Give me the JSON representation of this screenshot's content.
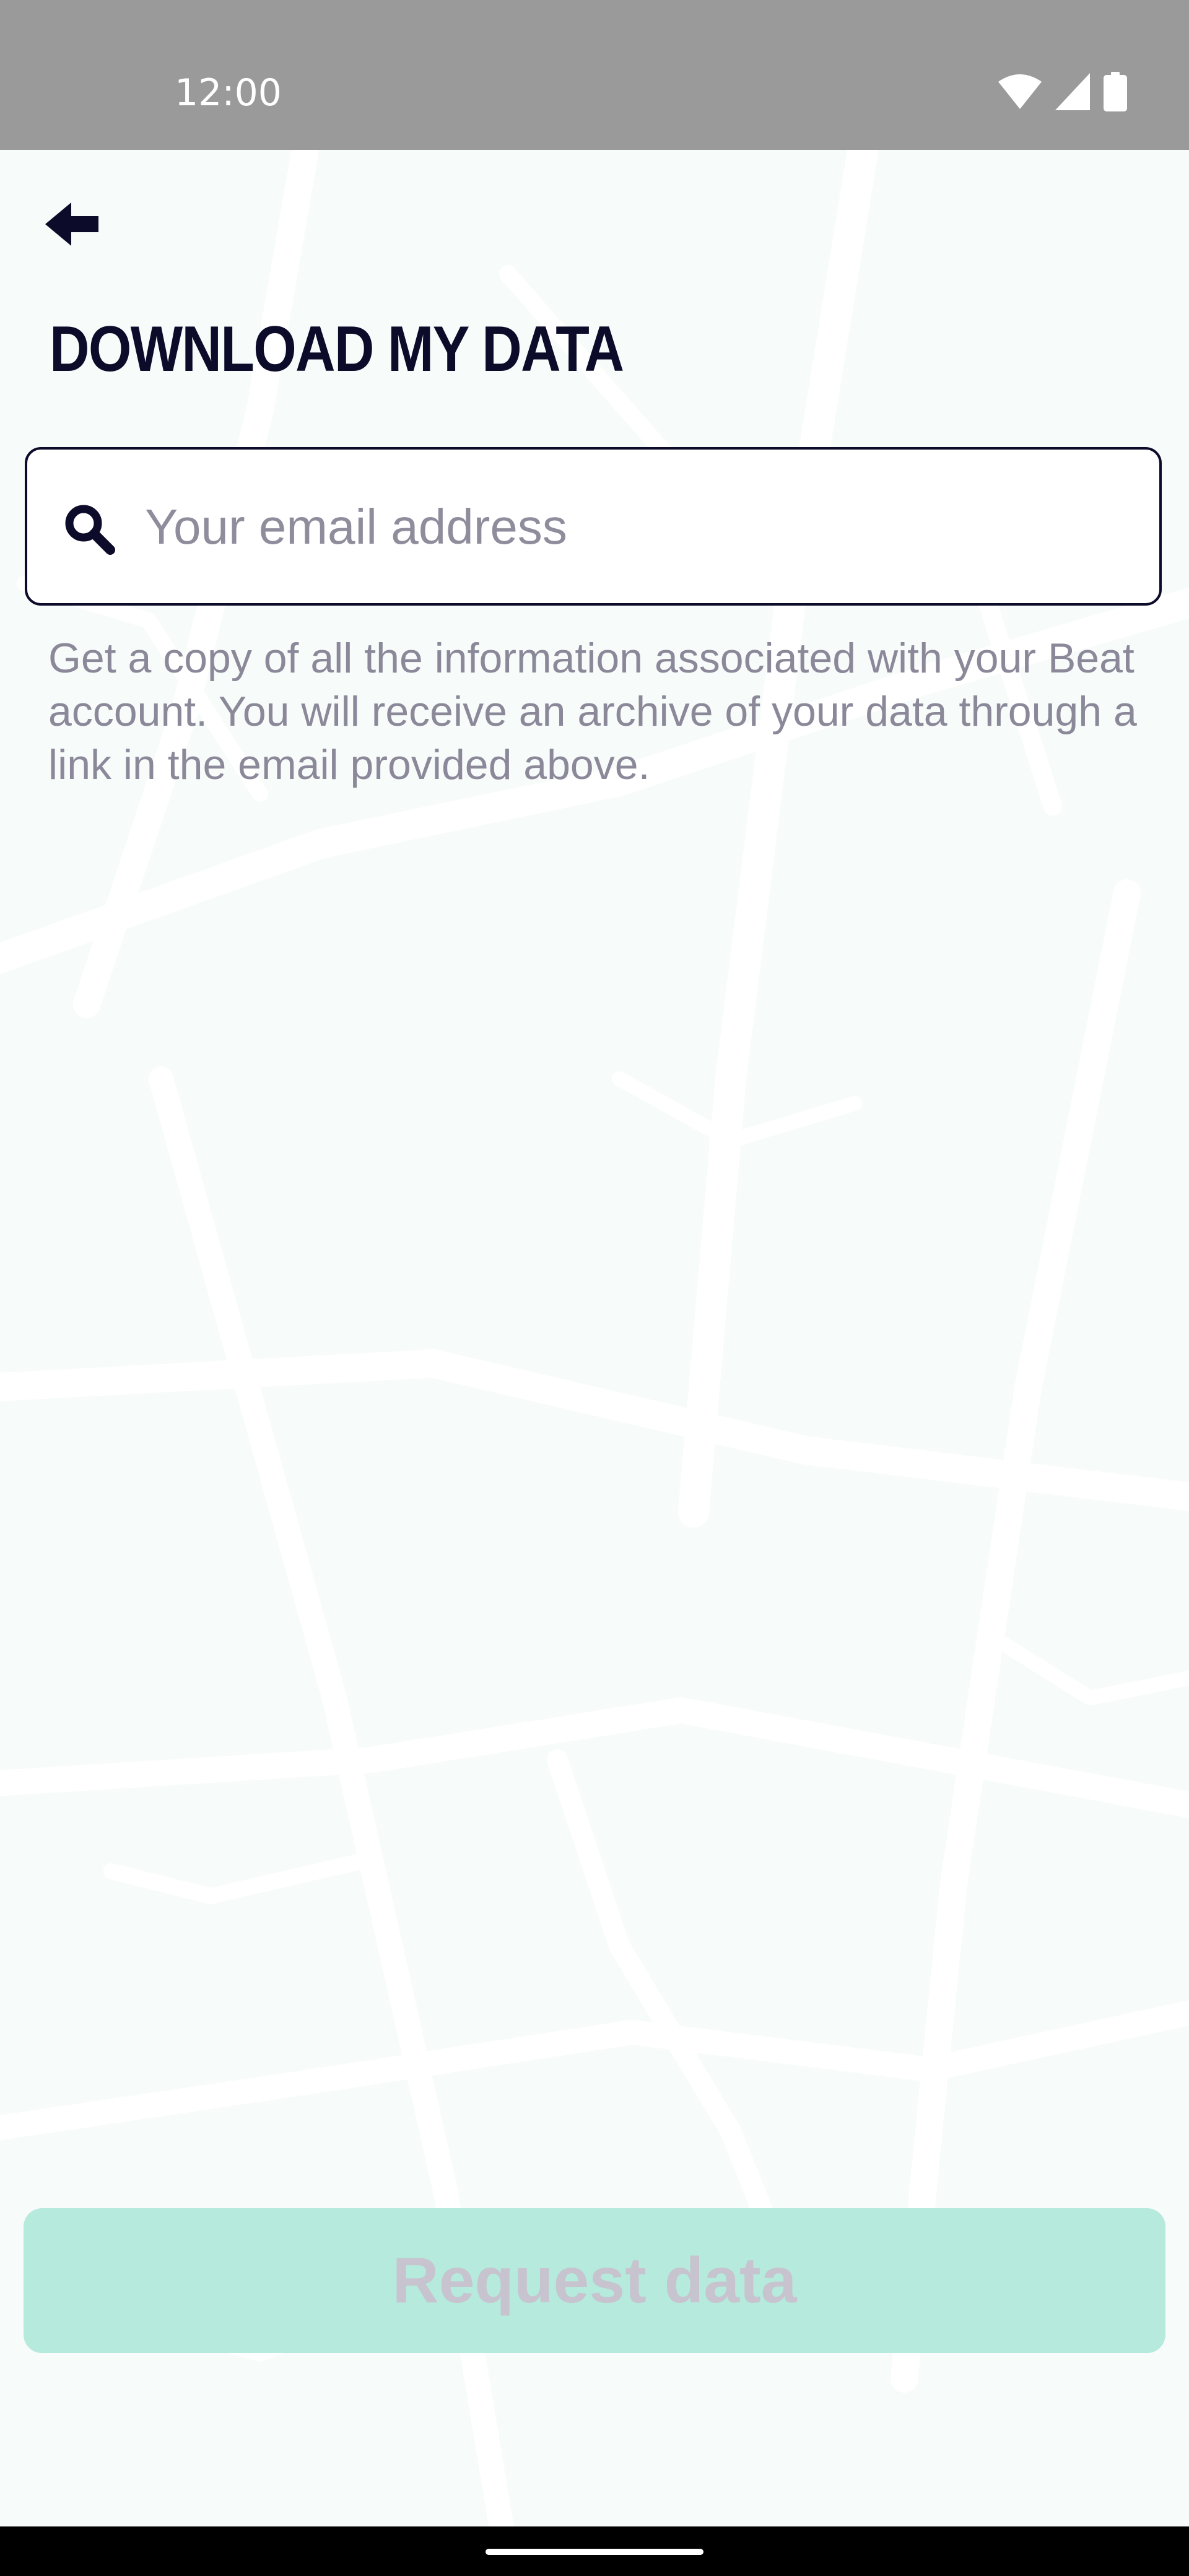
{
  "status_bar": {
    "time": "12:00",
    "icons": [
      "wifi-icon",
      "cell-signal-icon",
      "battery-icon"
    ]
  },
  "header": {
    "back_icon": "arrow-left-icon",
    "title": "DOWNLOAD MY DATA"
  },
  "email": {
    "icon": "search-icon",
    "value": "",
    "placeholder": "Your email address"
  },
  "description": "Get a copy of all the information associated with your Beat account. You will receive an archive of your data through a link in the email provided above.",
  "request_button": {
    "label": "Request data",
    "state": "disabled"
  },
  "colors": {
    "status_bar": "#9a9a9a",
    "background": "#f7fbfa",
    "map_lines": "#ffffff",
    "title": "#0d0b2a",
    "field_border": "#0d0b2a",
    "placeholder": "#8f8d9c",
    "description": "#8b8999",
    "button_bg": "#b5eadc",
    "button_text": "#c7c3cf",
    "nav_bar": "#000000"
  }
}
